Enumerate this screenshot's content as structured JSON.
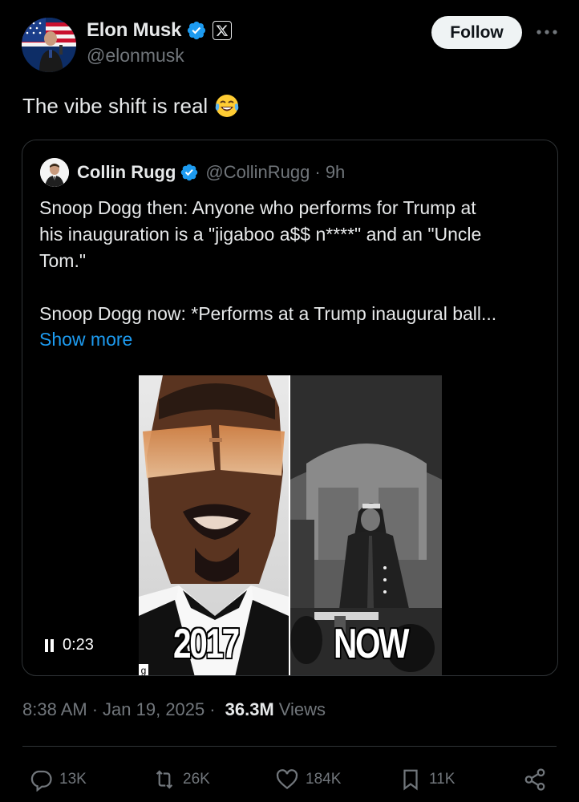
{
  "author": {
    "display_name": "Elon Musk",
    "handle": "@elonmusk",
    "affiliate_badge": "X"
  },
  "follow_label": "Follow",
  "tweet_text": "The vibe shift is real",
  "quoted": {
    "display_name": "Collin Rugg",
    "handle": "@CollinRugg",
    "time": "· 9h",
    "lines": [
      "Snoop Dogg then: Anyone who performs for Trump at",
      "his inauguration is a \"jigaboo a$$ n****\" and an \"Uncle",
      "Tom.\""
    ],
    "lines2": [
      "Snoop Dogg now: *Performs at a Trump inaugural ball..."
    ],
    "show_more": "Show more",
    "video": {
      "left_label": "2017",
      "right_label": "NOW",
      "timestamp": "0:23",
      "tag": "g"
    }
  },
  "meta": {
    "time": "8:38 AM",
    "date": "Jan 19, 2025",
    "views_count": "36.3M",
    "views_label": "Views"
  },
  "actions": {
    "replies": "13K",
    "reposts": "26K",
    "likes": "184K",
    "bookmarks": "11K"
  },
  "colors": {
    "background": "#000000",
    "text": "#e7e9ea",
    "muted": "#71767b",
    "link": "#1d9bf0",
    "verified": "#1d9bf0",
    "border": "#2f3336"
  },
  "icons": [
    "verified-badge-icon",
    "x-logo-icon",
    "more-icon",
    "tears-of-joy-emoji",
    "pause-icon",
    "reply-icon",
    "repost-icon",
    "like-icon",
    "bookmark-icon",
    "share-icon"
  ]
}
